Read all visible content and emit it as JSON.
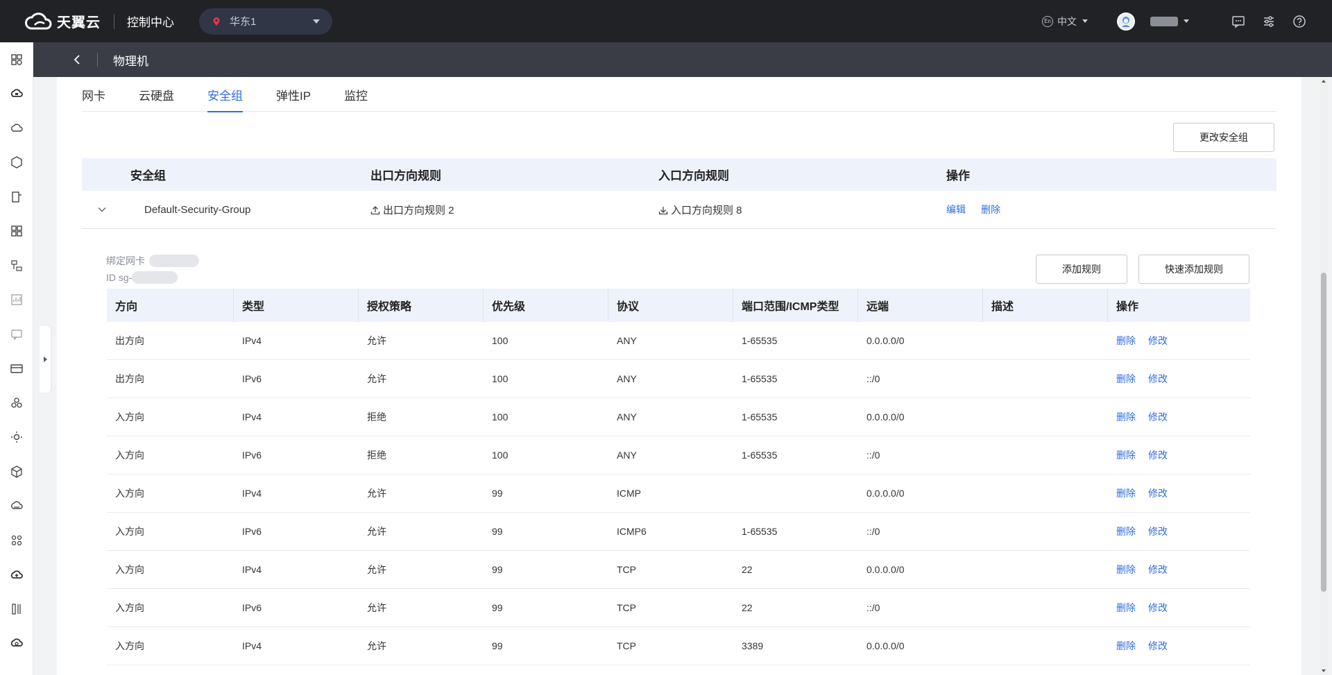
{
  "topbar": {
    "brand": "天翼云",
    "console": "控制中心",
    "region": "华东1",
    "language": "中文",
    "language_badge": "En"
  },
  "sidebar": {
    "icons": [
      "dashboard-icon",
      "cloud-server-icon",
      "cloud-icon",
      "hexagon-icon",
      "host-icon",
      "grid-icon",
      "network-icon",
      "chart-icon",
      "message-icon",
      "card-icon",
      "cluster-icon",
      "settings-gear-icon",
      "cube-icon",
      "cloud-storage-icon",
      "apps-icon",
      "cloud-upload-icon",
      "bars-icon",
      "cloud-sync-icon"
    ]
  },
  "page": {
    "title": "物理机"
  },
  "tabs": [
    {
      "label": "网卡",
      "active": false
    },
    {
      "label": "云硬盘",
      "active": false
    },
    {
      "label": "安全组",
      "active": true
    },
    {
      "label": "弹性IP",
      "active": false
    },
    {
      "label": "监控",
      "active": false
    }
  ],
  "actions": {
    "change_security_group": "更改安全组",
    "add_rule": "添加规则",
    "quick_add_rule": "快速添加规则"
  },
  "security_group_table": {
    "headers": [
      "安全组",
      "出口方向规则",
      "入口方向规则",
      "操作"
    ],
    "row": {
      "name": "Default-Security-Group",
      "egress": "出口方向规则 2",
      "ingress": "入口方向规则 8",
      "edit": "编辑",
      "delete": "删除"
    }
  },
  "meta": {
    "bound_nic_label": "绑定网卡",
    "id_label": "ID sg-"
  },
  "rules_table": {
    "headers": [
      "方向",
      "类型",
      "授权策略",
      "优先级",
      "协议",
      "端口范围/ICMP类型",
      "远端",
      "描述",
      "操作"
    ],
    "delete_label": "删除",
    "modify_label": "修改",
    "rows": [
      [
        "出方向",
        "IPv4",
        "允许",
        "100",
        "ANY",
        "1-65535",
        "0.0.0.0/0",
        ""
      ],
      [
        "出方向",
        "IPv6",
        "允许",
        "100",
        "ANY",
        "1-65535",
        "::/0",
        ""
      ],
      [
        "入方向",
        "IPv4",
        "拒绝",
        "100",
        "ANY",
        "1-65535",
        "0.0.0.0/0",
        ""
      ],
      [
        "入方向",
        "IPv6",
        "拒绝",
        "100",
        "ANY",
        "1-65535",
        "::/0",
        ""
      ],
      [
        "入方向",
        "IPv4",
        "允许",
        "99",
        "ICMP",
        "",
        "0.0.0.0/0",
        ""
      ],
      [
        "入方向",
        "IPv6",
        "允许",
        "99",
        "ICMP6",
        "1-65535",
        "::/0",
        ""
      ],
      [
        "入方向",
        "IPv4",
        "允许",
        "99",
        "TCP",
        "22",
        "0.0.0.0/0",
        ""
      ],
      [
        "入方向",
        "IPv6",
        "允许",
        "99",
        "TCP",
        "22",
        "::/0",
        ""
      ],
      [
        "入方向",
        "IPv4",
        "允许",
        "99",
        "TCP",
        "3389",
        "0.0.0.0/0",
        ""
      ]
    ]
  },
  "colors": {
    "accent": "#2f6de1",
    "topbar": "#202226",
    "header": "#3a3d45",
    "table_header": "#eef2fb"
  }
}
